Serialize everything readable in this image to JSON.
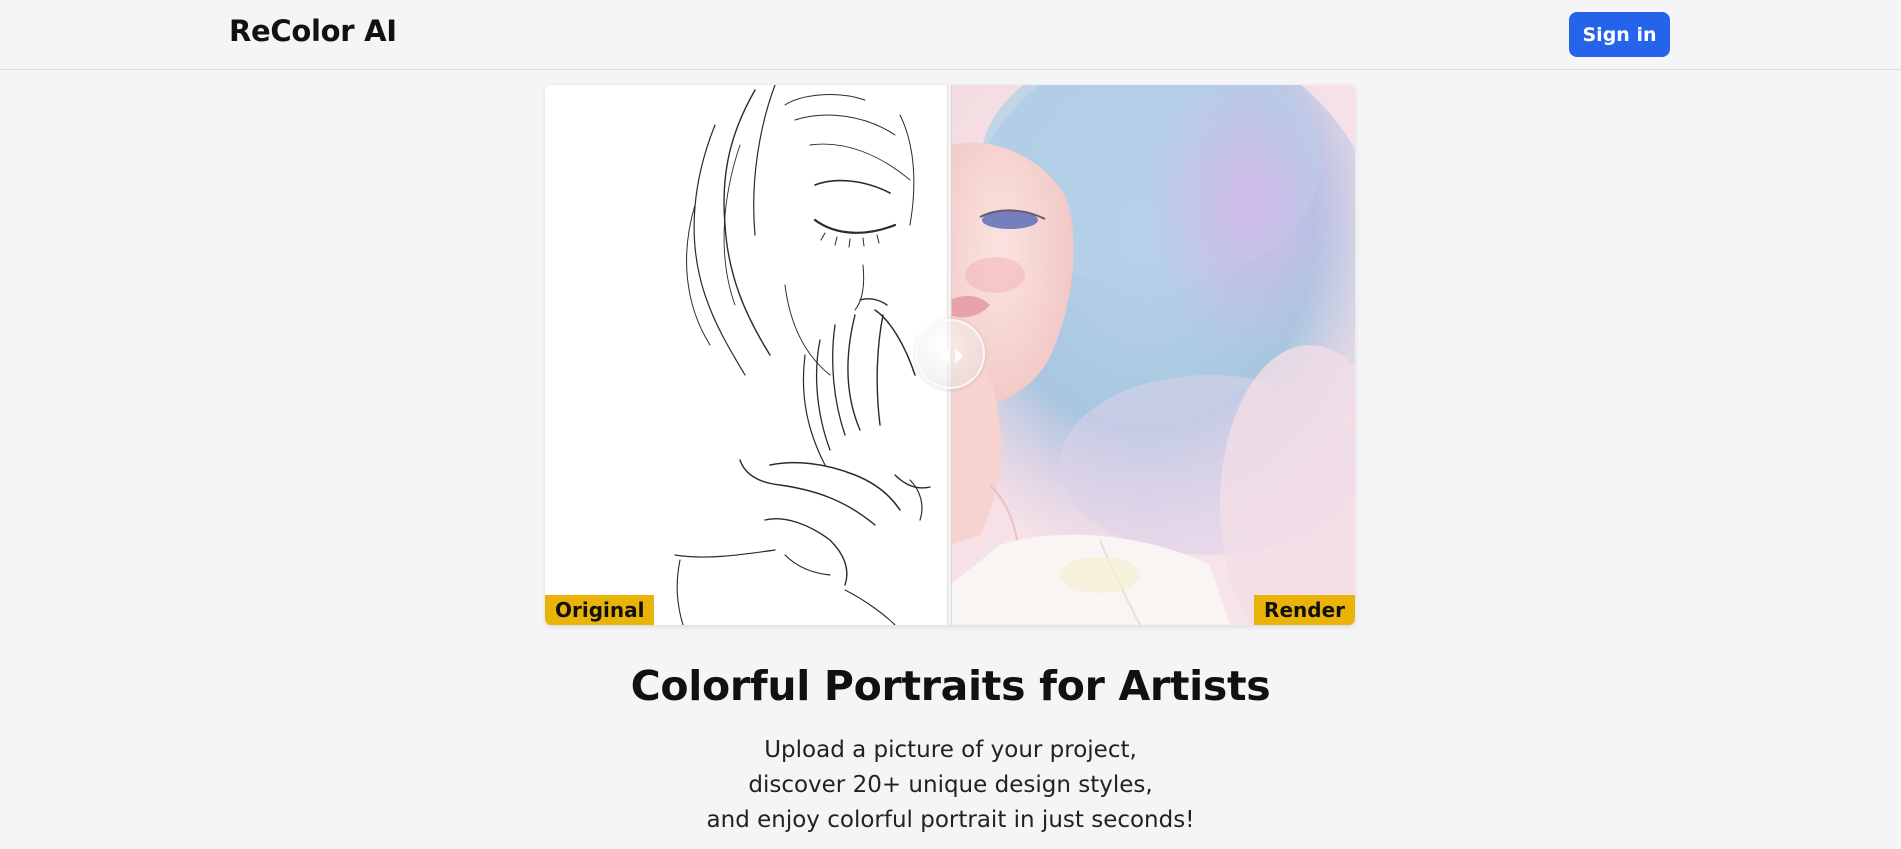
{
  "header": {
    "brand": "ReColor AI",
    "signin_label": "Sign in"
  },
  "comparison": {
    "left_label": "Original",
    "right_label": "Render",
    "slider_position": 0.5
  },
  "hero": {
    "title": "Colorful Portraits for Artists",
    "lines": [
      "Upload a picture of your project,",
      "discover 20+ unique design styles,",
      "and enjoy colorful portrait in just seconds!"
    ]
  },
  "colors": {
    "accent": "#2563eb",
    "tag": "#eab308",
    "background": "#f5f5f7"
  }
}
